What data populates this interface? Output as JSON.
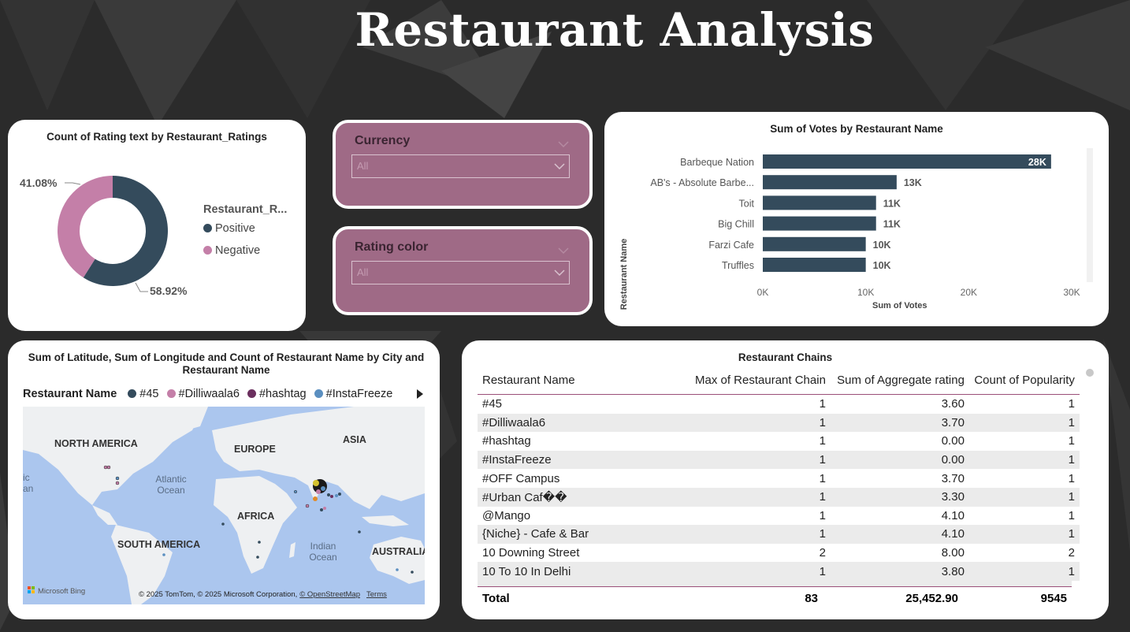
{
  "title": "Restaurant Analysis",
  "donut": {
    "title": "Count of Rating text by Restaurant_Ratings",
    "legend_title": "Restaurant_R...",
    "chart_data": {
      "type": "pie",
      "categories": [
        "Positive",
        "Negative"
      ],
      "values": [
        58.92,
        41.08
      ],
      "labels": [
        "58.92%",
        "41.08%"
      ],
      "colors": [
        "#344b5c",
        "#c47fa8"
      ]
    }
  },
  "slicers": [
    {
      "label": "Currency",
      "value": "All"
    },
    {
      "label": "Rating color",
      "value": "All"
    }
  ],
  "votes": {
    "title": "Sum of Votes by Restaurant Name",
    "ylabel": "Restaurant Name",
    "xlabel": "Sum of Votes",
    "chart_data": {
      "type": "bar",
      "categories": [
        "Barbeque Nation",
        "AB's - Absolute Barbe...",
        "Toit",
        "Big Chill",
        "Farzi Cafe",
        "Truffles"
      ],
      "values": [
        28000,
        13000,
        11000,
        11000,
        10000,
        10000
      ],
      "data_labels": [
        "28K",
        "13K",
        "11K",
        "11K",
        "10K",
        "10K"
      ],
      "xticks": [
        "0K",
        "10K",
        "20K",
        "30K"
      ],
      "xlim": [
        0,
        30000
      ],
      "color": "#344b5c"
    }
  },
  "map": {
    "title": "Sum of Latitude, Sum of Longitude and Count of Restaurant Name by City and Restaurant Name",
    "legend_title": "Restaurant Name",
    "legend": [
      {
        "name": "#45",
        "color": "#344b5c"
      },
      {
        "name": "#Dilliwaala6",
        "color": "#c47fa8"
      },
      {
        "name": "#hashtag",
        "color": "#6b2f5e"
      },
      {
        "name": "#InstaFreeze",
        "color": "#5b8fc0"
      }
    ],
    "labels": {
      "north_america": "NORTH AMERICA",
      "europe": "EUROPE",
      "asia": "ASIA",
      "africa": "AFRICA",
      "south_america": "SOUTH AMERICA",
      "australia": "AUSTRALIA",
      "atlantic": "Atlantic\nOcean",
      "indian": "Indian\nOcean",
      "edge_left": "ic\nan"
    },
    "attribution": "© 2025 TomTom, © 2025 Microsoft Corporation,",
    "osm": "© OpenStreetMap",
    "terms": "Terms",
    "bing": "Microsoft Bing"
  },
  "table": {
    "title": "Restaurant Chains",
    "headers": [
      "Restaurant Name",
      "Max of Restaurant Chain",
      "Sum of Aggregate rating",
      "Count of Popularity"
    ],
    "rows": [
      [
        "#45",
        "1",
        "3.60",
        "1"
      ],
      [
        "#Dilliwaala6",
        "1",
        "3.70",
        "1"
      ],
      [
        "#hashtag",
        "1",
        "0.00",
        "1"
      ],
      [
        "#InstaFreeze",
        "1",
        "0.00",
        "1"
      ],
      [
        "#OFF Campus",
        "1",
        "3.70",
        "1"
      ],
      [
        "#Urban Caf��",
        "1",
        "3.30",
        "1"
      ],
      [
        "@Mango",
        "1",
        "4.10",
        "1"
      ],
      [
        "{Niche} - Cafe & Bar",
        "1",
        "4.10",
        "1"
      ],
      [
        "10 Downing Street",
        "2",
        "8.00",
        "2"
      ],
      [
        "10 To 10 In Delhi",
        "1",
        "3.80",
        "1"
      ]
    ],
    "total": {
      "label": "Total",
      "chain": "83",
      "rating": "25,452.90",
      "popularity": "9545"
    }
  }
}
